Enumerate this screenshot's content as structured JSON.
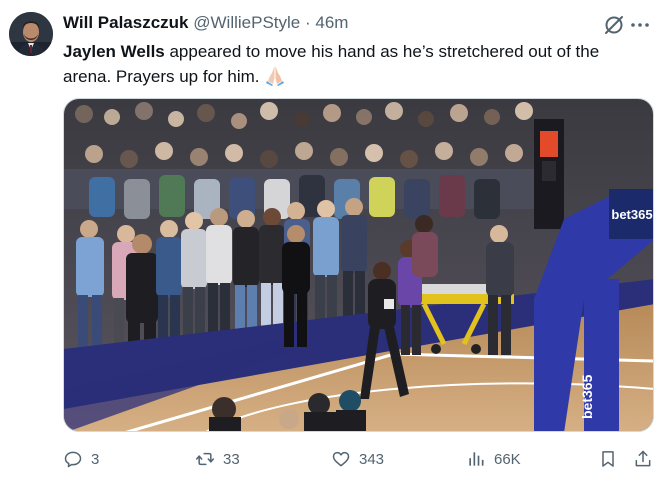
{
  "tweet": {
    "author": {
      "display_name": "Will Palaszczuk",
      "handle": "@WilliePStyle",
      "separator": "·",
      "time": "46m"
    },
    "text": {
      "mention": "Jaylen Wells",
      "body": " appeared to move his hand as he’s stretchered out of the arena. Prayers up for him. ",
      "emoji": "pray-emoji"
    },
    "media": {
      "type": "video-frame",
      "scoreboard_text": "bet365",
      "stanchion_text": "bet365"
    },
    "actions": {
      "replies": "3",
      "reposts": "33",
      "likes": "343",
      "views": "66K"
    }
  },
  "colors": {
    "text_primary": "#0f1419",
    "text_secondary": "#536471",
    "border": "#cfd9de",
    "court_wood": "#c89e6a",
    "court_blue": "#2b2f7a"
  }
}
